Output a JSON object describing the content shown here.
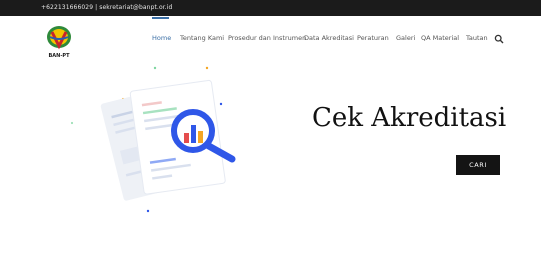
{
  "topbar": {
    "contact": "+622131666029 | sekretariat@banpt.or.id"
  },
  "logo": {
    "text": "BAN-PT"
  },
  "nav": {
    "items": [
      {
        "label": "Home",
        "active": true
      },
      {
        "label": "Tentang Kami"
      },
      {
        "label": "Prosedur dan Instrumen"
      },
      {
        "label": "Data Akreditasi"
      },
      {
        "label": "Peraturan"
      },
      {
        "label": "Galeri"
      },
      {
        "label": "QA Material"
      },
      {
        "label": "Tautan"
      }
    ],
    "search_icon": "search-icon"
  },
  "hero": {
    "title": "Cek Akreditasi",
    "button_label": "CARI"
  },
  "colors": {
    "topbar_bg": "#1b1b1b",
    "accent": "#3a6ea5",
    "magnifier": "#2f57e8",
    "button_bg": "#141414"
  }
}
